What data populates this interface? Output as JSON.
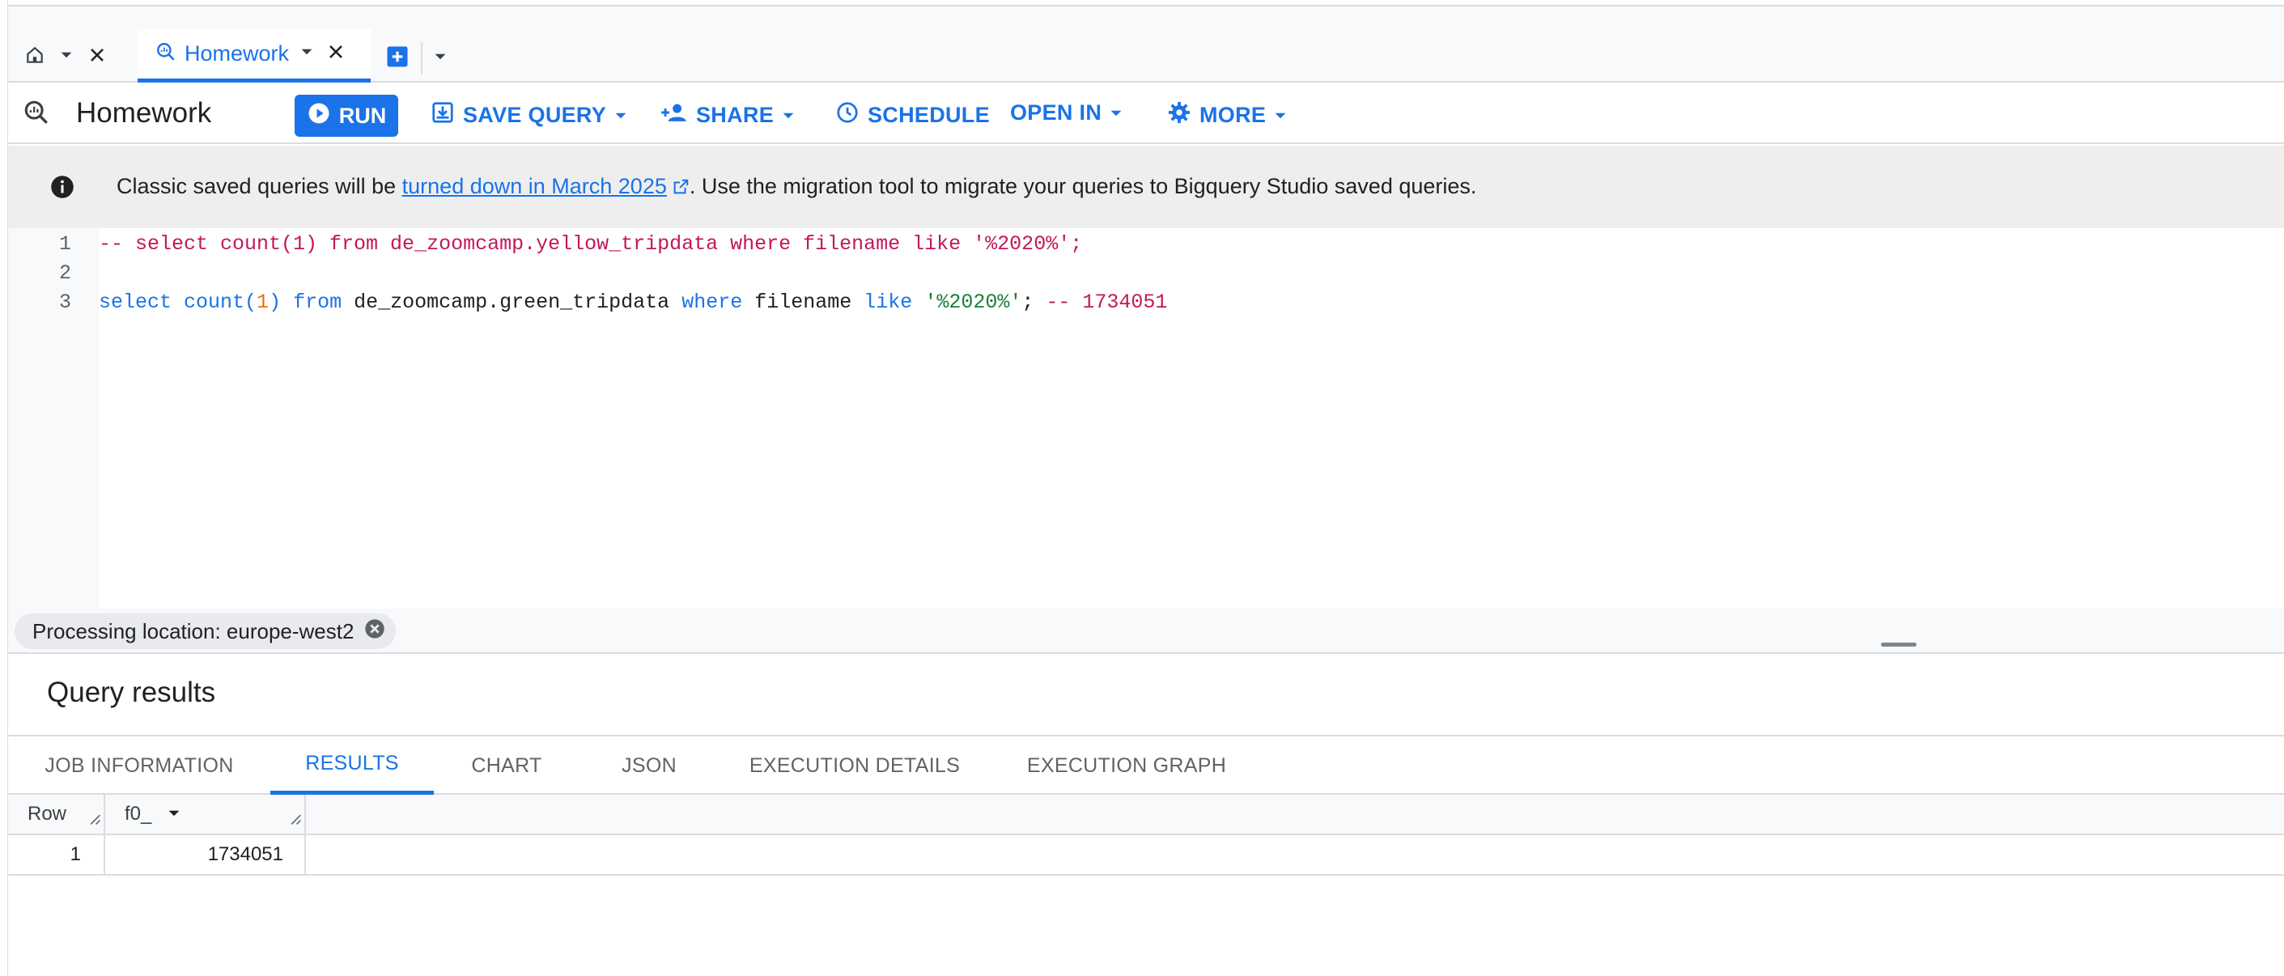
{
  "tabs": {
    "home_icon": "home-icon",
    "active": {
      "label": "Homework",
      "icon": "query-icon"
    },
    "add_icon": "add-tab-icon"
  },
  "toolbar": {
    "title": "Homework",
    "run_label": "RUN",
    "save_label": "SAVE QUERY",
    "share_label": "SHARE",
    "schedule_label": "SCHEDULE",
    "open_in_label": "OPEN IN",
    "more_label": "MORE"
  },
  "banner": {
    "text_before": "Classic saved queries will be ",
    "link_text": "turned down in March 2025",
    "text_after": ". Use the migration tool to migrate your queries to Bigquery Studio saved queries."
  },
  "editor": {
    "line_numbers": [
      "1",
      "2",
      "3"
    ],
    "line1": "-- select count(1) from de_zoomcamp.yellow_tripdata where filename like '%2020%';",
    "line3": {
      "kw_select": "select",
      "fn_count": "count(",
      "num": "1",
      "close": ")",
      "kw_from": "from",
      "table": "de_zoomcamp.green_tripdata",
      "kw_where": "where",
      "col": "filename",
      "kw_like": "like",
      "str": "'%2020%'",
      "semi": ";",
      "comment": "-- 1734051"
    }
  },
  "processing": {
    "label": "Processing location: europe-west2"
  },
  "results": {
    "title": "Query results",
    "tabs": [
      "JOB INFORMATION",
      "RESULTS",
      "CHART",
      "JSON",
      "EXECUTION DETAILS",
      "EXECUTION GRAPH"
    ],
    "active_tab": "RESULTS",
    "columns": [
      "Row",
      "f0_"
    ],
    "rows": [
      {
        "row": "1",
        "f0_": "1734051"
      }
    ]
  },
  "colors": {
    "accent": "#1a73e8",
    "comment": "#c2185b",
    "string": "#188038",
    "number": "#e8710a"
  }
}
